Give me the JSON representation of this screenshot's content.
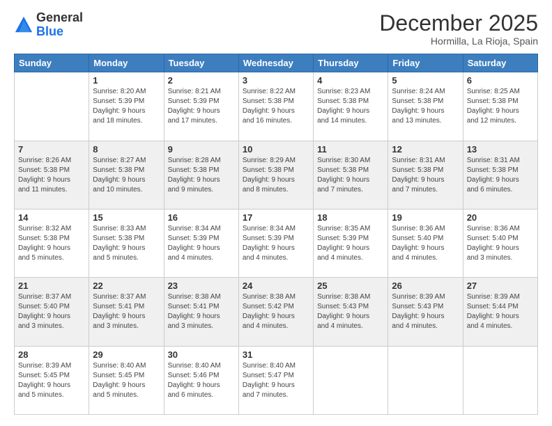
{
  "header": {
    "logo_general": "General",
    "logo_blue": "Blue",
    "month_title": "December 2025",
    "location": "Hormilla, La Rioja, Spain"
  },
  "weekdays": [
    "Sunday",
    "Monday",
    "Tuesday",
    "Wednesday",
    "Thursday",
    "Friday",
    "Saturday"
  ],
  "weeks": [
    [
      {
        "day": "",
        "info": ""
      },
      {
        "day": "1",
        "info": "Sunrise: 8:20 AM\nSunset: 5:39 PM\nDaylight: 9 hours\nand 18 minutes."
      },
      {
        "day": "2",
        "info": "Sunrise: 8:21 AM\nSunset: 5:39 PM\nDaylight: 9 hours\nand 17 minutes."
      },
      {
        "day": "3",
        "info": "Sunrise: 8:22 AM\nSunset: 5:38 PM\nDaylight: 9 hours\nand 16 minutes."
      },
      {
        "day": "4",
        "info": "Sunrise: 8:23 AM\nSunset: 5:38 PM\nDaylight: 9 hours\nand 14 minutes."
      },
      {
        "day": "5",
        "info": "Sunrise: 8:24 AM\nSunset: 5:38 PM\nDaylight: 9 hours\nand 13 minutes."
      },
      {
        "day": "6",
        "info": "Sunrise: 8:25 AM\nSunset: 5:38 PM\nDaylight: 9 hours\nand 12 minutes."
      }
    ],
    [
      {
        "day": "7",
        "info": "Sunrise: 8:26 AM\nSunset: 5:38 PM\nDaylight: 9 hours\nand 11 minutes."
      },
      {
        "day": "8",
        "info": "Sunrise: 8:27 AM\nSunset: 5:38 PM\nDaylight: 9 hours\nand 10 minutes."
      },
      {
        "day": "9",
        "info": "Sunrise: 8:28 AM\nSunset: 5:38 PM\nDaylight: 9 hours\nand 9 minutes."
      },
      {
        "day": "10",
        "info": "Sunrise: 8:29 AM\nSunset: 5:38 PM\nDaylight: 9 hours\nand 8 minutes."
      },
      {
        "day": "11",
        "info": "Sunrise: 8:30 AM\nSunset: 5:38 PM\nDaylight: 9 hours\nand 7 minutes."
      },
      {
        "day": "12",
        "info": "Sunrise: 8:31 AM\nSunset: 5:38 PM\nDaylight: 9 hours\nand 7 minutes."
      },
      {
        "day": "13",
        "info": "Sunrise: 8:31 AM\nSunset: 5:38 PM\nDaylight: 9 hours\nand 6 minutes."
      }
    ],
    [
      {
        "day": "14",
        "info": "Sunrise: 8:32 AM\nSunset: 5:38 PM\nDaylight: 9 hours\nand 5 minutes."
      },
      {
        "day": "15",
        "info": "Sunrise: 8:33 AM\nSunset: 5:38 PM\nDaylight: 9 hours\nand 5 minutes."
      },
      {
        "day": "16",
        "info": "Sunrise: 8:34 AM\nSunset: 5:39 PM\nDaylight: 9 hours\nand 4 minutes."
      },
      {
        "day": "17",
        "info": "Sunrise: 8:34 AM\nSunset: 5:39 PM\nDaylight: 9 hours\nand 4 minutes."
      },
      {
        "day": "18",
        "info": "Sunrise: 8:35 AM\nSunset: 5:39 PM\nDaylight: 9 hours\nand 4 minutes."
      },
      {
        "day": "19",
        "info": "Sunrise: 8:36 AM\nSunset: 5:40 PM\nDaylight: 9 hours\nand 4 minutes."
      },
      {
        "day": "20",
        "info": "Sunrise: 8:36 AM\nSunset: 5:40 PM\nDaylight: 9 hours\nand 3 minutes."
      }
    ],
    [
      {
        "day": "21",
        "info": "Sunrise: 8:37 AM\nSunset: 5:40 PM\nDaylight: 9 hours\nand 3 minutes."
      },
      {
        "day": "22",
        "info": "Sunrise: 8:37 AM\nSunset: 5:41 PM\nDaylight: 9 hours\nand 3 minutes."
      },
      {
        "day": "23",
        "info": "Sunrise: 8:38 AM\nSunset: 5:41 PM\nDaylight: 9 hours\nand 3 minutes."
      },
      {
        "day": "24",
        "info": "Sunrise: 8:38 AM\nSunset: 5:42 PM\nDaylight: 9 hours\nand 4 minutes."
      },
      {
        "day": "25",
        "info": "Sunrise: 8:38 AM\nSunset: 5:43 PM\nDaylight: 9 hours\nand 4 minutes."
      },
      {
        "day": "26",
        "info": "Sunrise: 8:39 AM\nSunset: 5:43 PM\nDaylight: 9 hours\nand 4 minutes."
      },
      {
        "day": "27",
        "info": "Sunrise: 8:39 AM\nSunset: 5:44 PM\nDaylight: 9 hours\nand 4 minutes."
      }
    ],
    [
      {
        "day": "28",
        "info": "Sunrise: 8:39 AM\nSunset: 5:45 PM\nDaylight: 9 hours\nand 5 minutes."
      },
      {
        "day": "29",
        "info": "Sunrise: 8:40 AM\nSunset: 5:45 PM\nDaylight: 9 hours\nand 5 minutes."
      },
      {
        "day": "30",
        "info": "Sunrise: 8:40 AM\nSunset: 5:46 PM\nDaylight: 9 hours\nand 6 minutes."
      },
      {
        "day": "31",
        "info": "Sunrise: 8:40 AM\nSunset: 5:47 PM\nDaylight: 9 hours\nand 7 minutes."
      },
      {
        "day": "",
        "info": ""
      },
      {
        "day": "",
        "info": ""
      },
      {
        "day": "",
        "info": ""
      }
    ]
  ]
}
